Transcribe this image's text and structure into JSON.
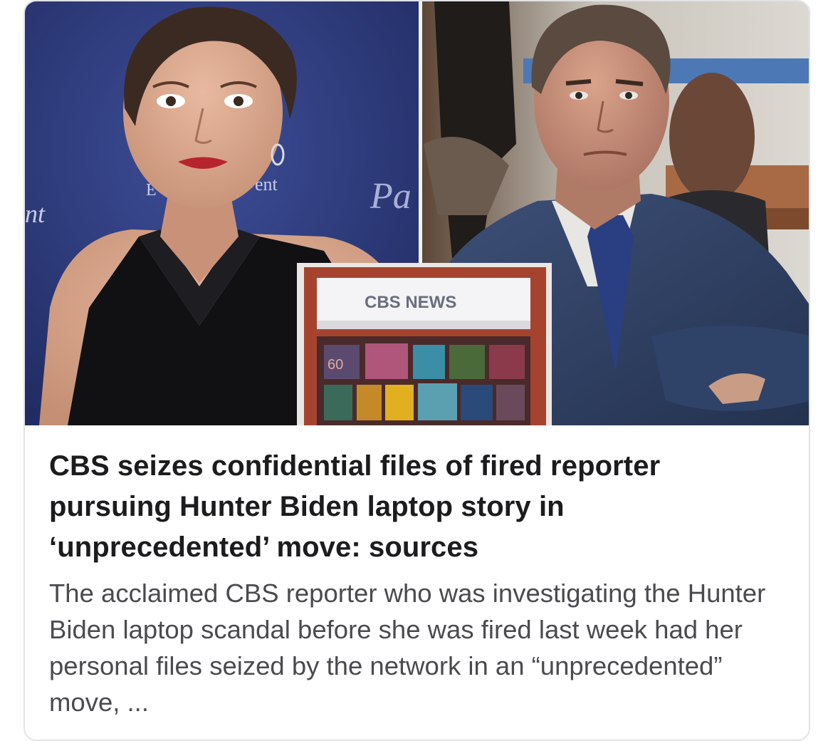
{
  "article": {
    "image": {
      "network_sign": "CBS NEWS",
      "backdrop_fragments": [
        "nt",
        "E",
        "ent",
        "Pa"
      ],
      "screen_badge": "60"
    },
    "headline": "CBS seizes confidential files of fired reporter pursuing Hunter Biden laptop story in ‘unprecedented’ move: sources",
    "summary": "The acclaimed CBS reporter who was investigating the Hunter Biden laptop scandal before she was fired last week had her personal files seized by the network in an “unprecedented” move, ..."
  },
  "colors": {
    "card_border": "#e2e2e6",
    "headline_text": "#1c1c1e",
    "summary_text": "#4a4a4f",
    "left_backdrop": "#2e3a78",
    "suit_navy": "#2c3d63",
    "sign_frame": "#a6432f"
  }
}
